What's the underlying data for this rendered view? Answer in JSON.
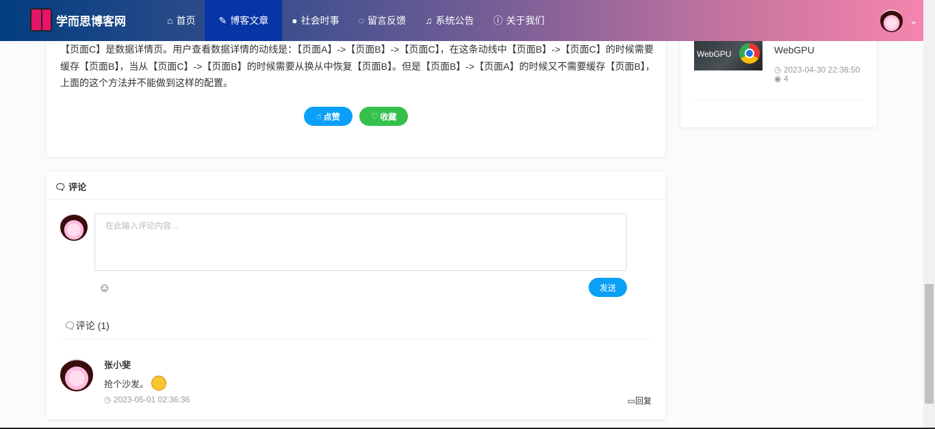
{
  "header": {
    "logo_text": "学而思博客网",
    "nav": [
      {
        "label": "首页",
        "icon": "home-icon"
      },
      {
        "label": "博客文章",
        "icon": "edit-icon",
        "active": true
      },
      {
        "label": "社会时事",
        "icon": "globe-icon"
      },
      {
        "label": "留言反馈",
        "icon": "comment-icon"
      },
      {
        "label": "系统公告",
        "icon": "bell-icon"
      },
      {
        "label": "关于我们",
        "icon": "info-icon"
      }
    ]
  },
  "article": {
    "body": "【页面C】是数据详情页。用户查看数据详情的动线是：【页面A】->【页面B】->【页面C】，在这条动线中【页面B】->【页面C】的时候需要缓存【页面B】，当从【页面C】->【页面B】的时候需要从换从中恢复【页面B】。但是【页面B】->【页面A】的时候又不需要缓存【页面B】，上面的这个方法并不能做到这样的配置。",
    "like_label": "点赞",
    "fav_label": "收藏"
  },
  "sidebar": {
    "post": {
      "thumb_text": "WebGPU",
      "title": "Chrome 发布 WebGPU",
      "date": "2023-04-30 22:38:50",
      "views": "4"
    }
  },
  "comments": {
    "title": "评论",
    "placeholder": "在此输入评论内容...",
    "send_label": "发送",
    "count_label": "评论 (1)",
    "items": [
      {
        "name": "张小斐",
        "text": "抢个沙发。",
        "time": "2023-05-01 02:36:36",
        "reply_label": "回复"
      }
    ]
  },
  "colors": {
    "primary": "#0aa0f7",
    "success": "#35c04c",
    "nav_active": "#0735a5"
  }
}
